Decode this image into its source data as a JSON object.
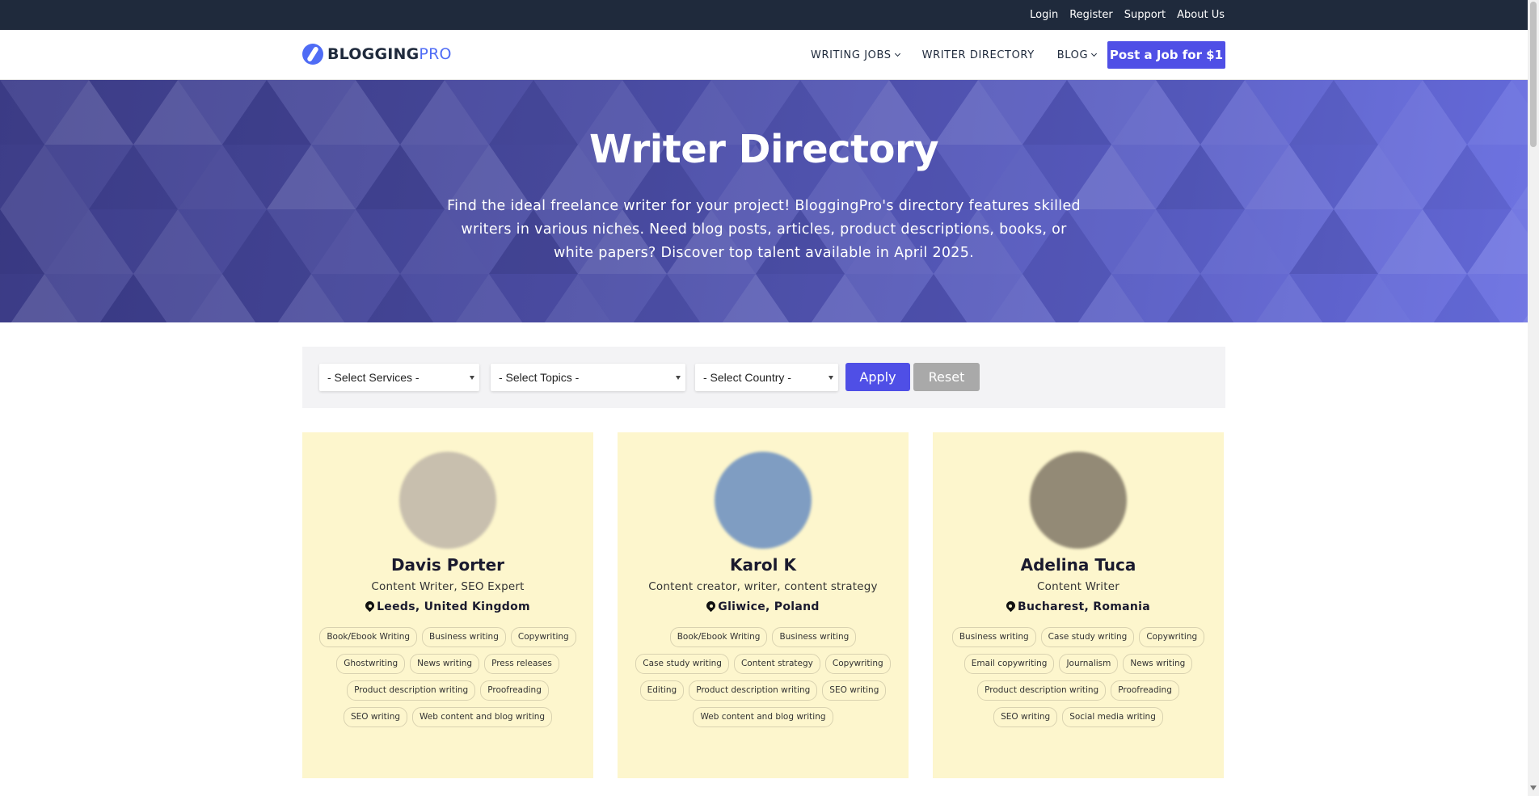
{
  "topbar": {
    "links": [
      "Login",
      "Register",
      "Support",
      "About Us"
    ]
  },
  "header": {
    "logo": {
      "part1": "BLOGGING",
      "part2": "PRO"
    },
    "nav": [
      {
        "label": "WRITING JOBS",
        "dropdown": true
      },
      {
        "label": "WRITER DIRECTORY",
        "dropdown": false
      },
      {
        "label": "BLOG",
        "dropdown": true
      }
    ],
    "cta": "Post a Job for $1"
  },
  "hero": {
    "title": "Writer Directory",
    "description": "Find the ideal freelance writer for your project! BloggingPro's directory features skilled writers in various niches. Need blog posts, articles, product descriptions, books, or white papers? Discover top talent available in April 2025."
  },
  "filters": {
    "services": "- Select Services -",
    "topics": "- Select Topics -",
    "country": "- Select Country -",
    "apply": "Apply",
    "reset": "Reset"
  },
  "writers": [
    {
      "name": "Davis Porter",
      "role": "Content Writer, SEO Expert",
      "location": "Leeds, United Kingdom",
      "avatar_color": "#c8bfae",
      "tags": [
        "Book/Ebook Writing",
        "Business writing",
        "Copywriting",
        "Ghostwriting",
        "News writing",
        "Press releases",
        "Product description writing",
        "Proofreading",
        "SEO writing",
        "Web content and blog writing"
      ]
    },
    {
      "name": "Karol K",
      "role": "Content creator, writer, content strategy",
      "location": "Gliwice, Poland",
      "avatar_color": "#7f9dc2",
      "tags": [
        "Book/Ebook Writing",
        "Business writing",
        "Case study writing",
        "Content strategy",
        "Copywriting",
        "Editing",
        "Product description writing",
        "SEO writing",
        "Web content and blog writing"
      ]
    },
    {
      "name": "Adelina Tuca",
      "role": "Content Writer",
      "location": "Bucharest, Romania",
      "avatar_color": "#938a76",
      "tags": [
        "Business writing",
        "Case study writing",
        "Copywriting",
        "Email copywriting",
        "Journalism",
        "News writing",
        "Product description writing",
        "Proofreading",
        "SEO writing",
        "Social media writing"
      ]
    }
  ],
  "colors": {
    "topbar": "#1f2a3c",
    "accent": "#4f4fe6",
    "card_bg": "#fdf6cd"
  }
}
